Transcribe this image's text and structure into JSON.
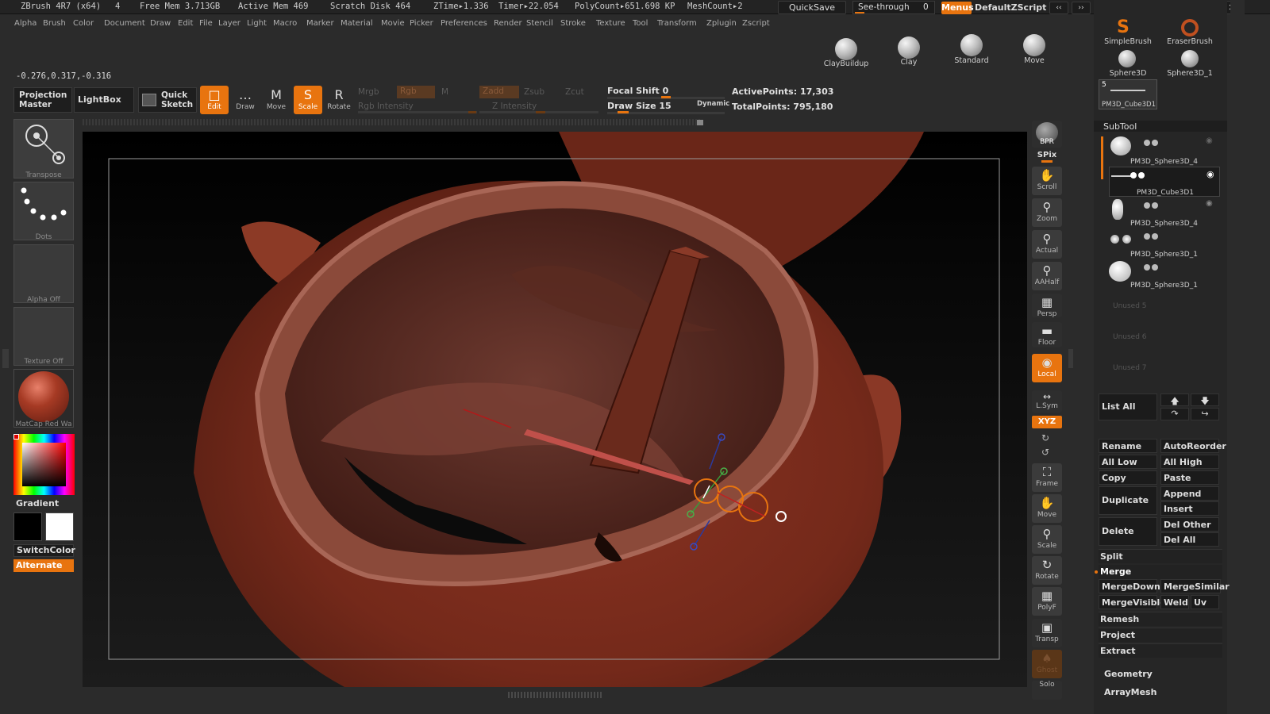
{
  "status": {
    "app": "ZBrush 4R7 (x64)",
    "num": "4",
    "free_mem": "Free Mem 3.713GB",
    "active_mem": "Active Mem 469",
    "scratch": "Scratch Disk 464",
    "ztime": "ZTime▸1.336",
    "timer": "Timer▸22.054",
    "polycount": "PolyCount▸651.698 KP",
    "meshcount": "MeshCount▸2",
    "quicksave": "QuickSave",
    "seethrough": "See-through",
    "seethrough_val": "0",
    "menus": "Menus",
    "script": "DefaultZScript"
  },
  "menu": [
    "Alpha",
    "Brush",
    "Color",
    "Document",
    "Draw",
    "Edit",
    "File",
    "Layer",
    "Light",
    "Macro",
    "Marker",
    "Material",
    "Movie",
    "Picker",
    "Preferences",
    "Render",
    "Stencil",
    "Stroke",
    "Texture",
    "Tool",
    "Transform",
    "Zplugin",
    "Zscript"
  ],
  "brush_shelf": [
    "ClayBuildup",
    "Clay",
    "Standard",
    "Move"
  ],
  "coords": "-0.276,0.317,-0.316",
  "toolbar": {
    "projection_master": "Projection Master",
    "lightbox": "LightBox",
    "quick_sketch": "Quick Sketch",
    "edit": "Edit",
    "draw": "Draw",
    "move": "Move",
    "scale": "Scale",
    "rotate": "Rotate",
    "mrgb": "Mrgb",
    "rgb": "Rgb",
    "m": "M",
    "zadd": "Zadd",
    "zsub": "Zsub",
    "zcut": "Zcut",
    "rgb_intensity": "Rgb Intensity",
    "z_intensity": "Z Intensity",
    "focal_shift": "Focal Shift 0",
    "draw_size": "Draw Size 15",
    "dynamic": "Dynamic",
    "active_points": "ActivePoints: 17,303",
    "total_points": "TotalPoints: 795,180"
  },
  "left_panel": {
    "transpose": "Transpose",
    "dots": "Dots",
    "alpha": "Alpha Off",
    "texture": "Texture Off",
    "matcap": "MatCap Red Wa",
    "gradient": "Gradient",
    "switchcolor": "SwitchColor",
    "alternate": "Alternate"
  },
  "right_shelf": [
    "BPR",
    "SPix",
    "Scroll",
    "Zoom",
    "Actual",
    "AAHalf",
    "Persp",
    "Floor",
    "Local",
    "L.Sym",
    "XYZ",
    "Frame",
    "Move",
    "Scale",
    "Rotate",
    "PolyF",
    "Transp",
    "Ghost",
    "Solo"
  ],
  "right_panel": {
    "tools": [
      {
        "name": "SimpleBrush"
      },
      {
        "name": "EraserBrush"
      },
      {
        "name": "Sphere3D"
      },
      {
        "name": "Sphere3D_1"
      }
    ],
    "current_tool": "PM3D_Cube3D1",
    "current_tool_badge": "5",
    "subtool_title": "SubTool",
    "subtools": [
      "PM3D_Sphere3D_4",
      "PM3D_Cube3D1",
      "PM3D_Sphere3D_4",
      "PM3D_Sphere3D_1",
      "PM3D_Sphere3D_1"
    ],
    "unused": [
      "Unused 5",
      "Unused 6",
      "Unused 7"
    ],
    "list_all": "List All",
    "buttons": {
      "rename": "Rename",
      "autoreorder": "AutoReorder",
      "all_low": "All Low",
      "all_high": "All High",
      "copy": "Copy",
      "paste": "Paste",
      "duplicate": "Duplicate",
      "append": "Append",
      "insert": "Insert",
      "delete": "Delete",
      "del_other": "Del Other",
      "del_all": "Del All",
      "split": "Split",
      "merge": "Merge",
      "mergedown": "MergeDown",
      "mergesimilar": "MergeSimilar",
      "mergevisible": "MergeVisible",
      "weld": "Weld",
      "uv": "Uv",
      "remesh": "Remesh",
      "project": "Project",
      "extract": "Extract",
      "geometry": "Geometry",
      "arraymesh": "ArrayMesh"
    }
  },
  "colors": {
    "accent": "#e8740f",
    "model": "#7a2a1c",
    "panel": "#2b2b2b"
  }
}
